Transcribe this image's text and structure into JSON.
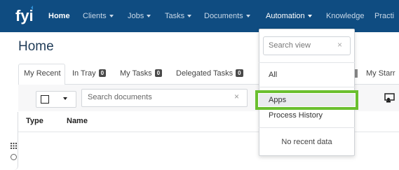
{
  "nav": {
    "logo_text": "fyi",
    "items": [
      {
        "label": "Home",
        "active": true,
        "has_caret": false
      },
      {
        "label": "Clients",
        "has_caret": true
      },
      {
        "label": "Jobs",
        "has_caret": true
      },
      {
        "label": "Tasks",
        "has_caret": true
      },
      {
        "label": "Documents",
        "has_caret": true
      },
      {
        "label": "Automation",
        "has_caret": true
      },
      {
        "label": "Knowledge",
        "has_caret": false
      },
      {
        "label": "Practi",
        "has_caret": false
      }
    ]
  },
  "page": {
    "title": "Home"
  },
  "tabs": [
    {
      "label": "My Recent",
      "active": true
    },
    {
      "label": "In Tray",
      "badge": "0"
    },
    {
      "label": "My Tasks",
      "badge": "0"
    },
    {
      "label": "Delegated Tasks",
      "badge": "0"
    },
    {
      "label": "My Starr"
    }
  ],
  "toolbar": {
    "search_placeholder": "Search documents",
    "clear_symbol": "×"
  },
  "table": {
    "columns": [
      "Type",
      "Name"
    ]
  },
  "dropdown": {
    "search_placeholder": "Search view",
    "clear_symbol": "×",
    "items": [
      {
        "label": "All"
      },
      {
        "label": "Apps",
        "highlighted": true
      },
      {
        "label": "Process History"
      }
    ],
    "empty_text": "No recent data"
  },
  "colors": {
    "topbar": "#0f4c81",
    "highlight_border": "#6abf2f",
    "badge": "#4a4a4a"
  }
}
